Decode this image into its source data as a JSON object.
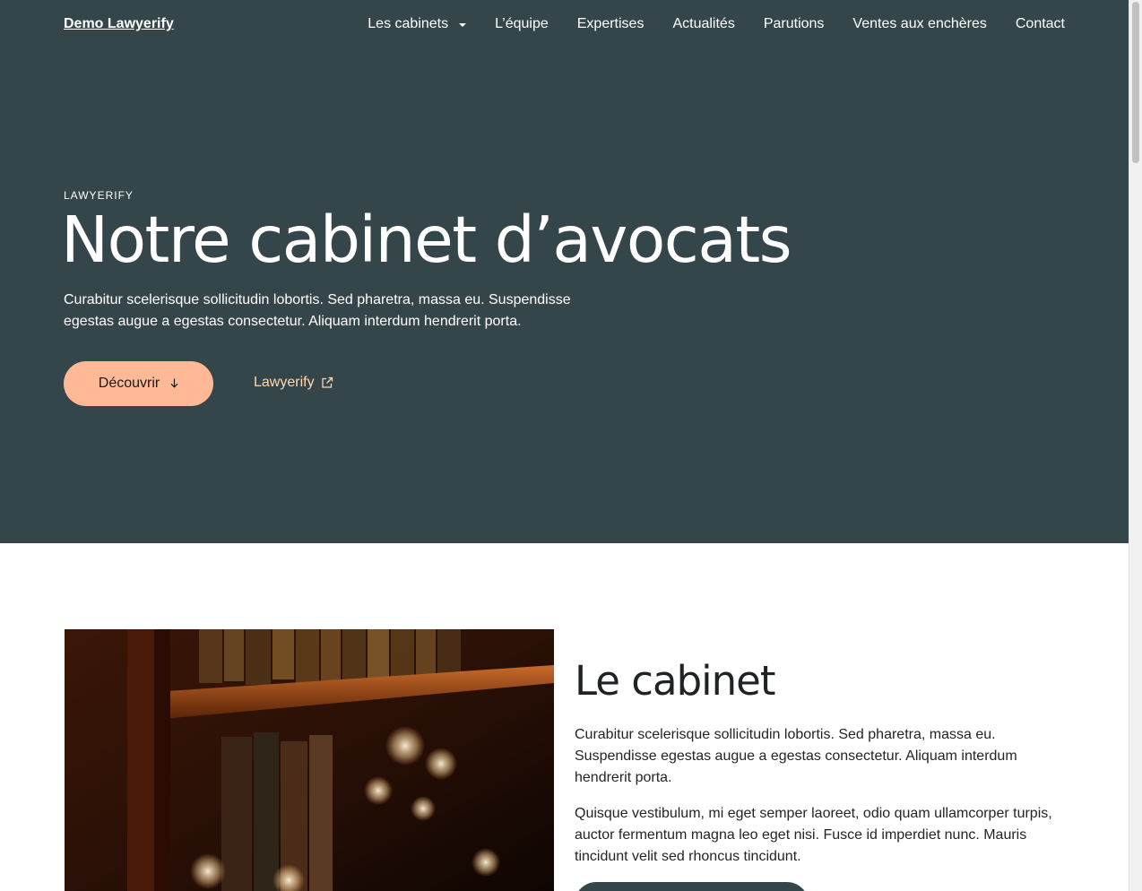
{
  "navbar": {
    "brand": "Demo Lawyerify",
    "items": [
      {
        "label": "Les cabinets",
        "has_dropdown": true
      },
      {
        "label": "L’équipe"
      },
      {
        "label": "Expertises"
      },
      {
        "label": "Actualités"
      },
      {
        "label": "Parutions"
      },
      {
        "label": "Ventes aux enchères"
      },
      {
        "label": "Contact"
      }
    ]
  },
  "hero": {
    "eyebrow": "LAWYERIFY",
    "title": "Notre cabinet d’avocats",
    "text": "Curabitur scelerisque sollicitudin lobortis. Sed pharetra, massa eu. Suspendisse egestas augue a egestas consectetur. Aliquam interdum hendrerit porta.",
    "primary_button": {
      "label": "Découvrir",
      "icon": "arrow-down-icon"
    },
    "secondary_link": {
      "label": "Lawyerify",
      "icon": "external-link-icon"
    }
  },
  "cabinet": {
    "image_alt": "bookshelf-photo",
    "title": "Le cabinet",
    "p1": "Curabitur scelerisque sollicitudin lobortis. Sed pharetra, massa eu. Suspendisse egestas augue a egestas consectetur. Aliquam interdum hendrerit porta.",
    "p2": "Quisque vestibulum, mi eget semper laoreet, odio quam ullamcorper turpis, auctor fermentum magna leo eget nisi. Fusce id imperdiet nunc. Mauris tincidunt velit sed rhoncus tincidunt."
  },
  "colors": {
    "hero_bg": "#35464a",
    "accent": "#ffb996",
    "link": "#ffd8b0",
    "text_dark": "#212529"
  }
}
